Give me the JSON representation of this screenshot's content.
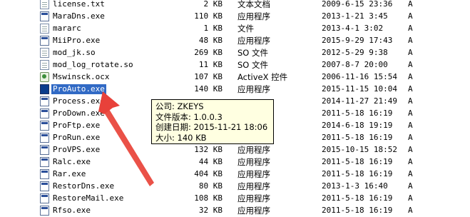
{
  "files": [
    {
      "name": "license.txt",
      "size": "2 KB",
      "type": "文本文档",
      "modified": "2009-6-15 23:36",
      "attr": "A",
      "icon": "text-file-icon"
    },
    {
      "name": "MaraDns.exe",
      "size": "110 KB",
      "type": "应用程序",
      "modified": "2013-1-21 3:45",
      "attr": "A",
      "icon": "exe-icon"
    },
    {
      "name": "mararc",
      "size": "1 KB",
      "type": "文件",
      "modified": "2013-4-1 3:02",
      "attr": "A",
      "icon": "file-icon"
    },
    {
      "name": "MiiPro.exe",
      "size": "48 KB",
      "type": "应用程序",
      "modified": "2015-9-29 17:43",
      "attr": "A",
      "icon": "exe-icon"
    },
    {
      "name": "mod_jk.so",
      "size": "269 KB",
      "type": "SO 文件",
      "modified": "2012-5-29 9:38",
      "attr": "A",
      "icon": "file-icon"
    },
    {
      "name": "mod_log_rotate.so",
      "size": "11 KB",
      "type": "SO 文件",
      "modified": "2007-8-7 20:00",
      "attr": "A",
      "icon": "file-icon"
    },
    {
      "name": "Mswinsck.ocx",
      "size": "107 KB",
      "type": "ActiveX 控件",
      "modified": "2006-11-16 15:54",
      "attr": "A",
      "icon": "activex-icon"
    },
    {
      "name": "ProAuto.exe",
      "size": "140 KB",
      "type": "应用程序",
      "modified": "2015-11-15 10:04",
      "attr": "A",
      "icon": "exe-blue-icon",
      "selected": true
    },
    {
      "name": "Process.exe",
      "size": "",
      "type": "",
      "modified": "2014-11-27 21:49",
      "attr": "A",
      "icon": "exe-icon"
    },
    {
      "name": "ProDown.exe",
      "size": "",
      "type": "",
      "modified": "2011-5-18 16:19",
      "attr": "A",
      "icon": "exe-icon"
    },
    {
      "name": "ProFtp.exe",
      "size": "",
      "type": "",
      "modified": "2014-6-18 19:19",
      "attr": "A",
      "icon": "exe-icon"
    },
    {
      "name": "ProRun.exe",
      "size": "",
      "type": "",
      "modified": "2011-5-18 16:19",
      "attr": "A",
      "icon": "exe-icon"
    },
    {
      "name": "ProVPS.exe",
      "size": "132 KB",
      "type": "应用程序",
      "modified": "2015-10-15 18:52",
      "attr": "A",
      "icon": "exe-icon"
    },
    {
      "name": "Ralc.exe",
      "size": "44 KB",
      "type": "应用程序",
      "modified": "2011-5-18 16:19",
      "attr": "A",
      "icon": "exe-icon"
    },
    {
      "name": "Rar.exe",
      "size": "404 KB",
      "type": "应用程序",
      "modified": "2011-5-18 16:19",
      "attr": "A",
      "icon": "exe-icon"
    },
    {
      "name": "RestorDns.exe",
      "size": "80 KB",
      "type": "应用程序",
      "modified": "2013-1-3 16:40",
      "attr": "A",
      "icon": "exe-icon"
    },
    {
      "name": "RestoreMail.exe",
      "size": "108 KB",
      "type": "应用程序",
      "modified": "2011-5-18 16:19",
      "attr": "A",
      "icon": "exe-icon"
    },
    {
      "name": "Rfso.exe",
      "size": "32 KB",
      "type": "应用程序",
      "modified": "2011-5-18 16:19",
      "attr": "A",
      "icon": "exe-icon"
    }
  ],
  "tooltip": {
    "company": "公司: ZKEYS",
    "version": "文件版本: 1.0.0.3",
    "created": "创建日期: 2015-11-21 18:06",
    "size": "大小: 140 KB"
  },
  "colors": {
    "selection": "#316ac5",
    "tooltip_bg": "#ffffe1",
    "arrow": "#e8413a"
  }
}
